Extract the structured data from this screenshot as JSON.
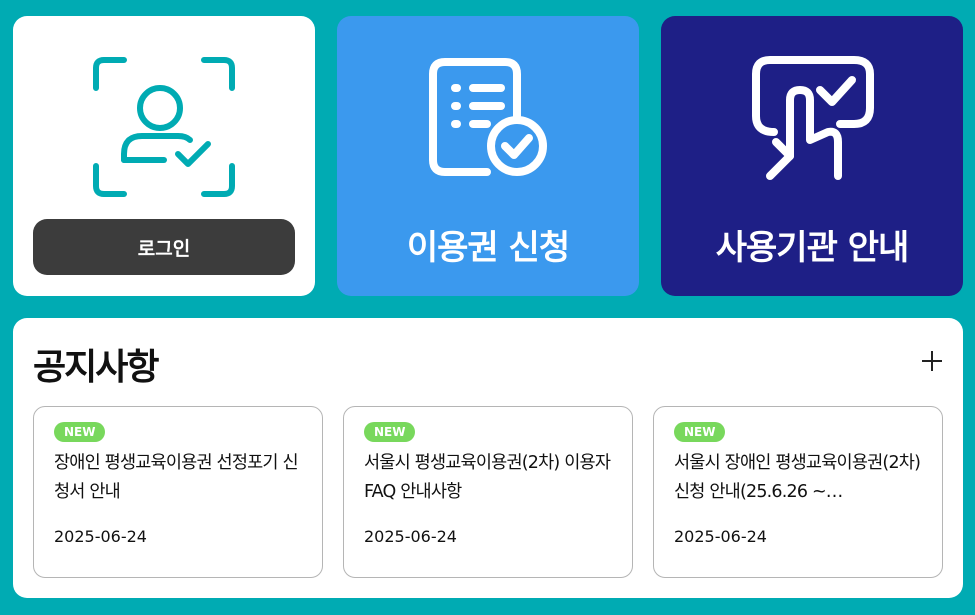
{
  "tiles": {
    "login": {
      "icon": "face-scan-user-check-icon",
      "button_label": "로그인"
    },
    "apply": {
      "icon": "document-check-icon",
      "label": "이용권 신청"
    },
    "guide": {
      "icon": "touch-select-check-icon",
      "label": "사용기관 안내"
    }
  },
  "notice": {
    "title": "공지사항",
    "more_icon": "plus-icon",
    "items": [
      {
        "badge": "NEW",
        "title": "장애인 평생교육이용권 선정포기 신청서 안내",
        "date": "2025-06-24"
      },
      {
        "badge": "NEW",
        "title": "서울시 평생교육이용권(2차) 이용자 FAQ 안내사항",
        "date": "2025-06-24"
      },
      {
        "badge": "NEW",
        "title": "서울시 장애인 평생교육이용권(2차) 신청 안내(25.6.26 ~…",
        "date": "2025-06-24"
      }
    ]
  },
  "colors": {
    "background": "#00abb3",
    "login_icon": "#00abb3",
    "login_button": "#3c3c3c",
    "apply_tile": "#3b99ee",
    "guide_tile": "#1e1f86",
    "badge": "#78d85c"
  }
}
